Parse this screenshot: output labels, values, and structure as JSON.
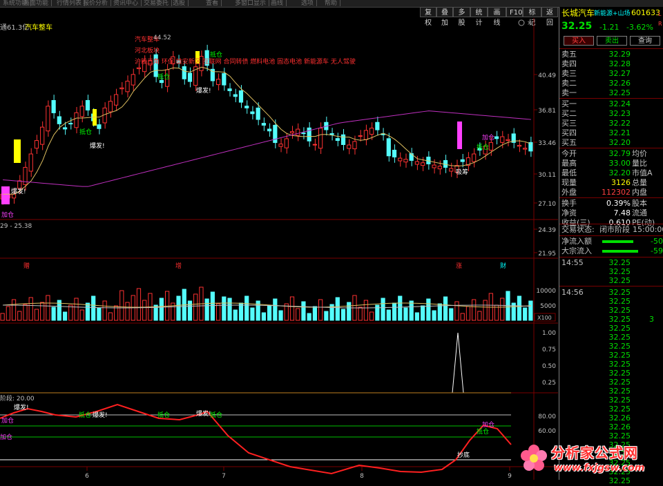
{
  "top_menu": [
    "系统功能",
    "画面功能",
    "行情列表",
    "报价分析",
    "资讯中心",
    "交易委托",
    "选股",
    "查看",
    "多窗口显示",
    "画线",
    "选项",
    "帮助"
  ],
  "toolbar": [
    "复权",
    "叠加",
    "多股",
    "统计",
    "画线",
    "F10",
    "标记",
    "返回"
  ],
  "main": {
    "header_prefix": "通61.3亿",
    "header_name": "汽车整车",
    "high_label": "44.52",
    "red_texts": [
      "汽车整车",
      "河北板块",
      "沪股三角 环保 雄安新区 互联网 合同转债 燃料电池 固态电池 新能源车 无人驾驶"
    ],
    "low_range": "29 - 25.38",
    "price_ticks": [
      "40.49",
      "36.81",
      "33.46",
      "30.11",
      "27.10",
      "24.39",
      "21.95"
    ],
    "signals": {
      "baofa": "爆发!",
      "dicang": "抵仓",
      "jiacang": "加仓",
      "xichou": "吸筹",
      "chaodi": "抄底"
    },
    "event_marks": [
      "赠",
      "增",
      "涨",
      "财"
    ]
  },
  "volume": {
    "ticks": [
      "10000",
      "5000"
    ],
    "unit": "X100"
  },
  "indicator1": {
    "ticks": [
      "1.00",
      "0.75",
      "0.50",
      "0.25"
    ]
  },
  "indicator2": {
    "title": "阶段: 20.00",
    "ticks": [
      "80.00",
      "60.00"
    ]
  },
  "dates": [
    "6",
    "7",
    "8",
    "9"
  ],
  "quote": {
    "name": "长城汽车",
    "tag": "新能源+山场",
    "code": "601633",
    "lr": "L R",
    "price": "32.25",
    "change": "-1.21",
    "pct": "-3.62%",
    "buy_btn": "买入",
    "sell_btn": "卖出",
    "query_btn": "查询",
    "asks": [
      {
        "label": "卖五",
        "price": "32.29",
        "vol": ""
      },
      {
        "label": "卖四",
        "price": "32.28",
        "vol": ""
      },
      {
        "label": "卖三",
        "price": "32.27",
        "vol": ""
      },
      {
        "label": "卖二",
        "price": "32.26",
        "vol": ""
      },
      {
        "label": "卖一",
        "price": "32.25",
        "vol": ""
      }
    ],
    "bids": [
      {
        "label": "买一",
        "price": "32.24",
        "vol": ""
      },
      {
        "label": "买二",
        "price": "32.23",
        "vol": ""
      },
      {
        "label": "买三",
        "price": "32.22",
        "vol": ""
      },
      {
        "label": "买四",
        "price": "32.21",
        "vol": ""
      },
      {
        "label": "买五",
        "price": "32.20",
        "vol": ""
      }
    ],
    "stats1": [
      {
        "l": "今开",
        "v": "32.79",
        "r": "均价"
      },
      {
        "l": "最高",
        "v": "33.00",
        "r": "量比"
      },
      {
        "l": "最低",
        "v": "32.20",
        "r": "市值A"
      },
      {
        "l": "现量",
        "v": "3126",
        "r": "总量"
      },
      {
        "l": "外盘",
        "v": "112302",
        "r": "内盘"
      }
    ],
    "stats2": [
      {
        "l": "换手",
        "v": "0.39%",
        "r": "股本"
      },
      {
        "l": "净资",
        "v": "7.48",
        "r": "流通"
      },
      {
        "l": "收益(三)",
        "v": "0.610",
        "r": "PE(动)"
      }
    ],
    "status_label": "交易状态:",
    "status_value": "闭市阶段",
    "status_time": "15:00:00",
    "flow": [
      {
        "l": "净流入额",
        "v": "-50"
      },
      {
        "l": "大宗流入",
        "v": "-59"
      }
    ],
    "ticks": [
      {
        "t": "14:55",
        "p": "32.25"
      },
      {
        "t": "",
        "p": "32.25"
      },
      {
        "t": "",
        "p": "32.25"
      },
      {
        "t": "14:56",
        "p": "32.25"
      },
      {
        "t": "",
        "p": "32.25"
      },
      {
        "t": "",
        "p": "32.25"
      },
      {
        "t": "",
        "p": "32.25"
      },
      {
        "t": "",
        "p": "32.25"
      },
      {
        "t": "",
        "p": "32.25"
      },
      {
        "t": "",
        "p": "32.25"
      },
      {
        "t": "",
        "p": "32.25"
      },
      {
        "t": "",
        "p": "32.25"
      },
      {
        "t": "",
        "p": "32.25"
      },
      {
        "t": "",
        "p": "32.25"
      },
      {
        "t": "",
        "p": "32.25"
      },
      {
        "t": "",
        "p": "32.25"
      },
      {
        "t": "",
        "p": "32.25"
      },
      {
        "t": "",
        "p": "32.26"
      },
      {
        "t": "",
        "p": "32.26"
      },
      {
        "t": "",
        "p": "32.25"
      },
      {
        "t": "",
        "p": "32.25"
      },
      {
        "t": "",
        "p": "32.25"
      },
      {
        "t": "",
        "p": "32.25"
      },
      {
        "t": "",
        "p": "32.25"
      },
      {
        "t": "",
        "p": "32.25"
      }
    ],
    "tick_vol_3": "3"
  },
  "watermark": {
    "cn": "分析家公式网",
    "url": "www.fxjgsw.com"
  },
  "colors": {
    "up": "#ff3232",
    "down": "#54fcfc",
    "ma_long": "#c030c0",
    "ma_short": "#e0c060"
  }
}
